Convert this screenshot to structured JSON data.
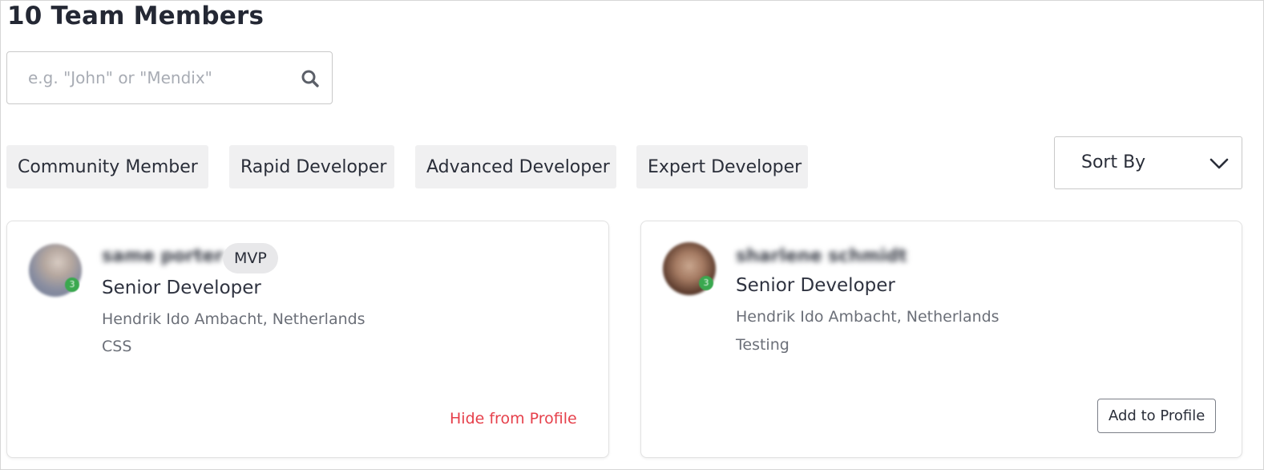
{
  "header": {
    "title": "10 Team Members"
  },
  "search": {
    "placeholder": "e.g. \"John\" or \"Mendix\"",
    "value": "",
    "icon": "search-icon"
  },
  "filters": [
    {
      "label": "Community Member"
    },
    {
      "label": "Rapid Developer"
    },
    {
      "label": "Advanced Developer"
    },
    {
      "label": "Expert Developer"
    }
  ],
  "sort": {
    "label": "Sort By",
    "icon": "chevron-down-icon"
  },
  "members": [
    {
      "name": "same porter",
      "tag": "MVP",
      "level_badge": "3",
      "role": "Senior Developer",
      "location": "Hendrik Ido Ambacht, Netherlands",
      "skill": "CSS",
      "action": "Hide from Profile"
    },
    {
      "name": "sharlene schmidt",
      "tag": "",
      "level_badge": "3",
      "role": "Senior Developer",
      "location": "Hendrik Ido Ambacht, Netherlands",
      "skill": "Testing",
      "action": "Add to Profile"
    }
  ],
  "colors": {
    "link_danger": "#e6404b",
    "badge_green": "#3aa84f",
    "chip_bg": "#f0f0f1"
  }
}
